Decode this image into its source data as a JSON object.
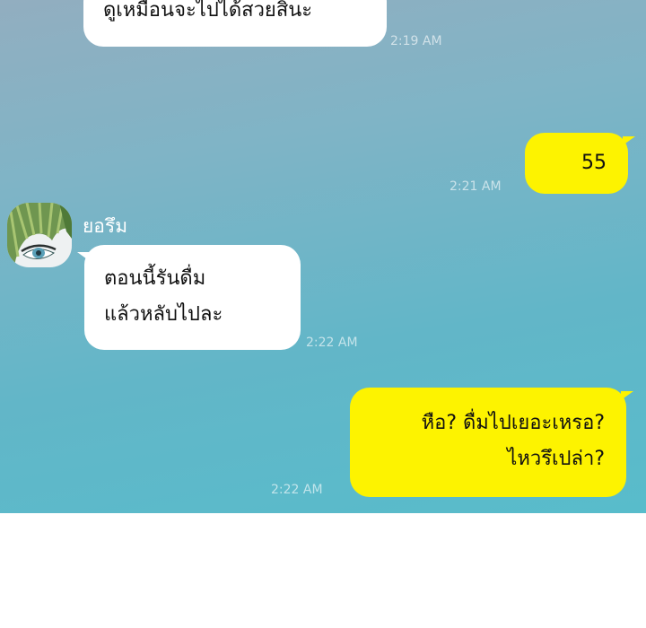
{
  "messages": [
    {
      "lines": [
        "ดูเหมือนจะไปได้สวยสินะ"
      ],
      "time": "2:19 AM"
    },
    {
      "lines": [
        "55"
      ],
      "time": "2:21 AM"
    },
    {
      "sender": "ยอรึม",
      "lines": [
        "ตอนนี้รันดื่ม",
        "แล้วหลับไปละ"
      ],
      "time": "2:22 AM"
    },
    {
      "lines": [
        "หือ? ดื่มไปเยอะเหรอ?",
        "ไหวรึเปล่า?"
      ],
      "time": "2:22 AM"
    }
  ],
  "colors": {
    "incoming_bubble": "#ffffff",
    "outgoing_bubble": "#fdf300",
    "background_top": "#92aec0",
    "background_bottom": "#58bccb"
  },
  "icons": {
    "avatar": "green-haired-character-avatar"
  }
}
